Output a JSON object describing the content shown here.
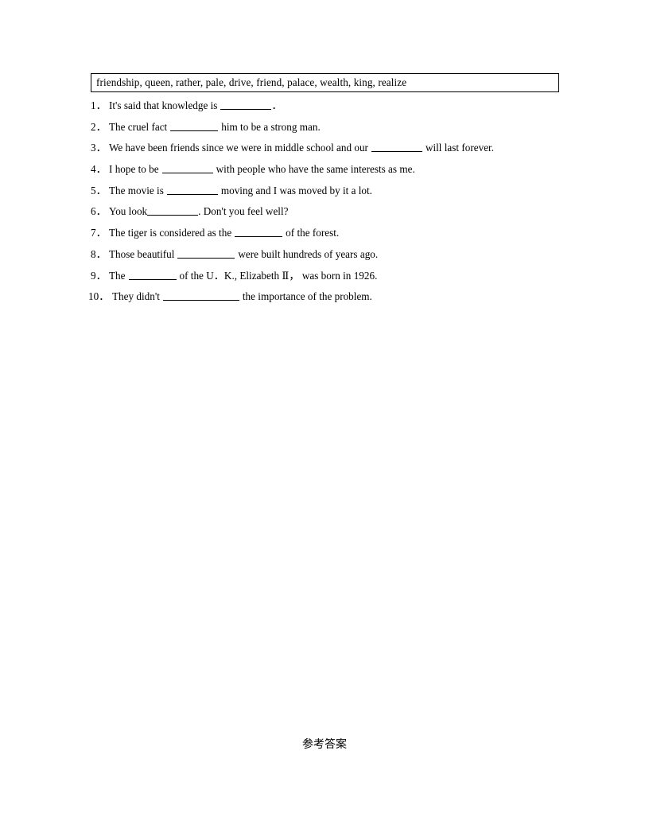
{
  "document": {
    "word_bank": "friendship, queen, rather, pale, drive, friend, palace, wealth, king, realize",
    "footer_note": "参考答案"
  },
  "questions": [
    {
      "number": "1．",
      "before": "It's said that knowledge is",
      "after": "．",
      "blank_width": "b-64"
    },
    {
      "number": "2．",
      "before": "The cruel fact",
      "after": "him to be a strong man.",
      "blank_width": "b-60"
    },
    {
      "number": "3．",
      "before": "We have been friends since we were in middle school and our",
      "after": "will last forever.",
      "blank_width": "b-64"
    },
    {
      "number": "4．",
      "before": "I hope to be",
      "after": "with people who have the same interests as me.",
      "blank_width": "b-64"
    },
    {
      "number": "5．",
      "before": "The movie is",
      "after": "moving and I was moved by it a lot.",
      "blank_width": "b-64"
    },
    {
      "number": "6．",
      "before": "You look",
      "after": ". Don't you feel well?",
      "blank_width": "b-64"
    },
    {
      "number": "7．",
      "before": "The tiger is considered as the",
      "after": "of the forest.",
      "blank_width": "b-60"
    },
    {
      "number": "8．",
      "before": "Those beautiful",
      "after": "were built hundreds of years ago.",
      "blank_width": "b-72"
    },
    {
      "number": "9．",
      "before": "The",
      "after": "of the U．K., Elizabeth Ⅱ，  was born in 1926.",
      "blank_width": "b-60"
    },
    {
      "number": "10．",
      "before": "They didn't",
      "after": "the importance of the problem.",
      "blank_width": "b-96"
    }
  ]
}
